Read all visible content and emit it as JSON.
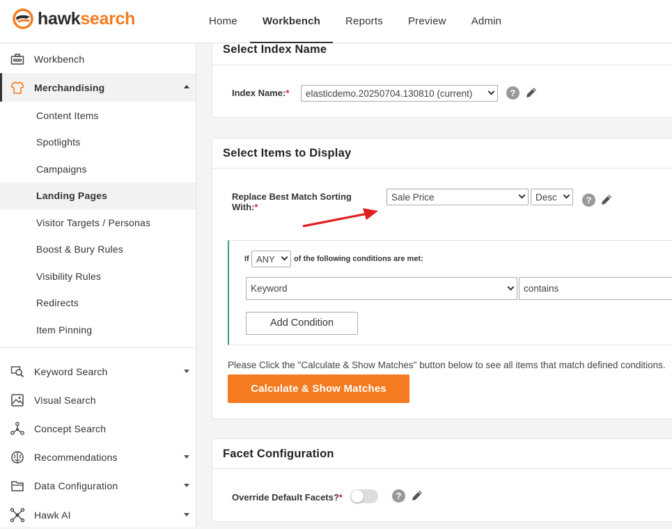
{
  "brand": {
    "name_part1": "hawk",
    "name_part2": "search",
    "accent": "#f47b20"
  },
  "nav": {
    "items": [
      {
        "label": "Home"
      },
      {
        "label": "Workbench",
        "active": true
      },
      {
        "label": "Reports"
      },
      {
        "label": "Preview"
      },
      {
        "label": "Admin"
      }
    ]
  },
  "sidebar": {
    "workbench": {
      "label": "Workbench",
      "icon": "toolbox-icon"
    },
    "merchandising": {
      "label": "Merchandising",
      "icon": "shirt-icon"
    },
    "sub_items": [
      {
        "label": "Content Items"
      },
      {
        "label": "Spotlights"
      },
      {
        "label": "Campaigns"
      },
      {
        "label": "Landing Pages",
        "active": true
      },
      {
        "label": "Visitor Targets / Personas"
      },
      {
        "label": "Boost & Bury Rules"
      },
      {
        "label": "Visibility Rules"
      },
      {
        "label": "Redirects"
      },
      {
        "label": "Item Pinning"
      }
    ],
    "sections": [
      {
        "label": "Keyword Search",
        "icon": "keyword-search-icon"
      },
      {
        "label": "Visual Search",
        "icon": "image-icon"
      },
      {
        "label": "Concept Search",
        "icon": "network-icon"
      },
      {
        "label": "Recommendations",
        "icon": "brain-icon"
      },
      {
        "label": "Data Configuration",
        "icon": "folder-icon"
      },
      {
        "label": "Hawk AI",
        "icon": "hawk-ai-icon"
      }
    ]
  },
  "index_card": {
    "title": "Select Index Name",
    "index_label": "Index Name:",
    "required_mark": "*",
    "index_value": "elasticdemo.20250704.130810 (current)"
  },
  "items_card": {
    "title": "Select Items to Display",
    "sort_label_line1": "Replace Best Match Sorting",
    "sort_label_line2": "With:",
    "required_mark": "*",
    "sort_field_value": "Sale Price",
    "sort_order_value": "Desc",
    "condition_prefix": "If",
    "condition_match_value": "ANY",
    "condition_suffix": "of the following conditions are met:",
    "condition_field_value": "Keyword",
    "condition_operator_value": "contains",
    "add_condition_label": "Add Condition",
    "instruction_text": "Please Click the \"Calculate & Show Matches\" button below to see all items that match defined conditions.",
    "calculate_label": "Calculate & Show Matches"
  },
  "facet_card": {
    "title": "Facet Configuration",
    "override_label": "Override Default Facets?",
    "required_mark": "*",
    "override_enabled": false
  },
  "help_glyph": "?"
}
